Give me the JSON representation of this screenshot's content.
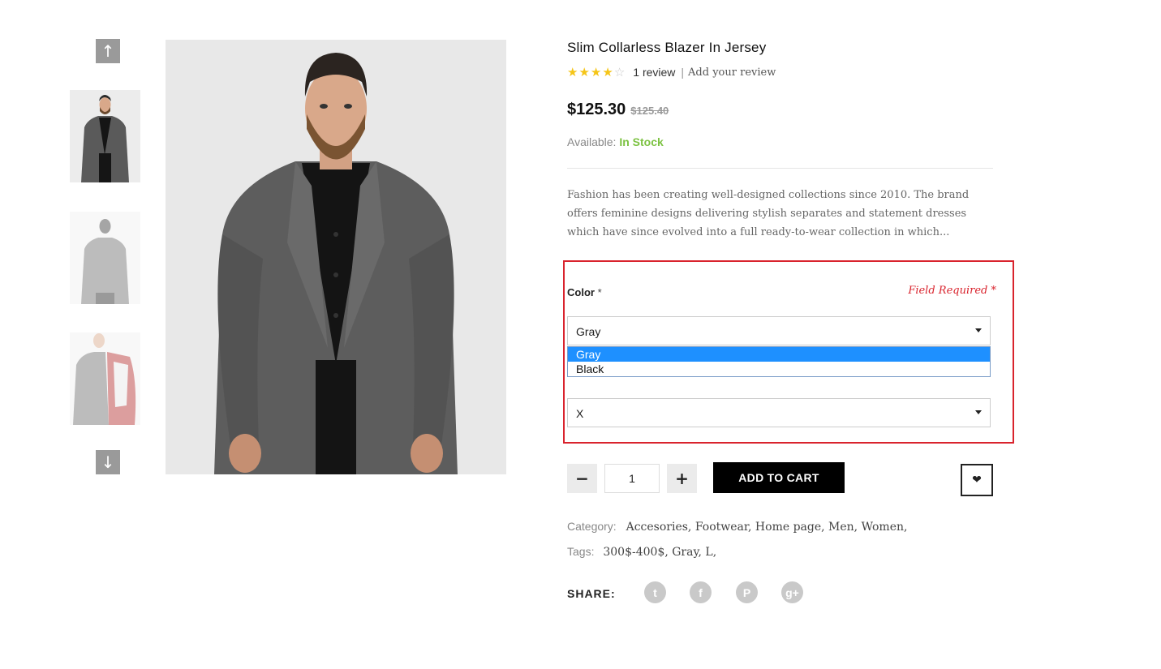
{
  "gallery": {
    "up_icon": "arrow-up-icon",
    "down_icon": "arrow-down-icon",
    "thumbnails": [
      "front view",
      "back view",
      "open jacket lining"
    ],
    "up_glyph": "↑",
    "down_glyph": "↓"
  },
  "product": {
    "title": "Slim Collarless Blazer In Jersey",
    "rating": {
      "value": 4,
      "max": 5
    },
    "review_count": "1 review",
    "separator": "|",
    "add_review": "Add your review",
    "price": "$125.30",
    "old_price": "$125.40",
    "availability_label": "Available:",
    "availability_value": "In Stock",
    "description": "Fashion has been creating well-designed collections since 2010. The brand offers feminine designs delivering stylish separates and statement dresses which have since evolved into a full ready-to-wear collection in which..."
  },
  "options": {
    "color_label": "Color",
    "required_mark": "*",
    "field_required": "Field Required *",
    "color_value": "Gray",
    "color_options": [
      "Gray",
      "Black"
    ],
    "size_value": "X"
  },
  "cart": {
    "minus": "−",
    "plus": "+",
    "quantity": "1",
    "add_to_cart": "ADD TO CART",
    "wishlist_glyph": "❤"
  },
  "meta": {
    "category_label": "Category:",
    "categories": "Accesories, Footwear, Home page, Men, Women,",
    "tags_label": "Tags:",
    "tags": "300$-400$, Gray, L,",
    "share_label": "SHARE:",
    "social": [
      {
        "icon": "twitter-icon",
        "glyph": "t"
      },
      {
        "icon": "facebook-icon",
        "glyph": "f"
      },
      {
        "icon": "pinterest-icon",
        "glyph": "P"
      },
      {
        "icon": "google-plus-icon",
        "glyph": "g+"
      }
    ]
  },
  "colors": {
    "accent_red": "#d9232d",
    "in_stock_green": "#7cc242",
    "star_yellow": "#f5c518",
    "dropdown_selected": "#1e90ff"
  }
}
